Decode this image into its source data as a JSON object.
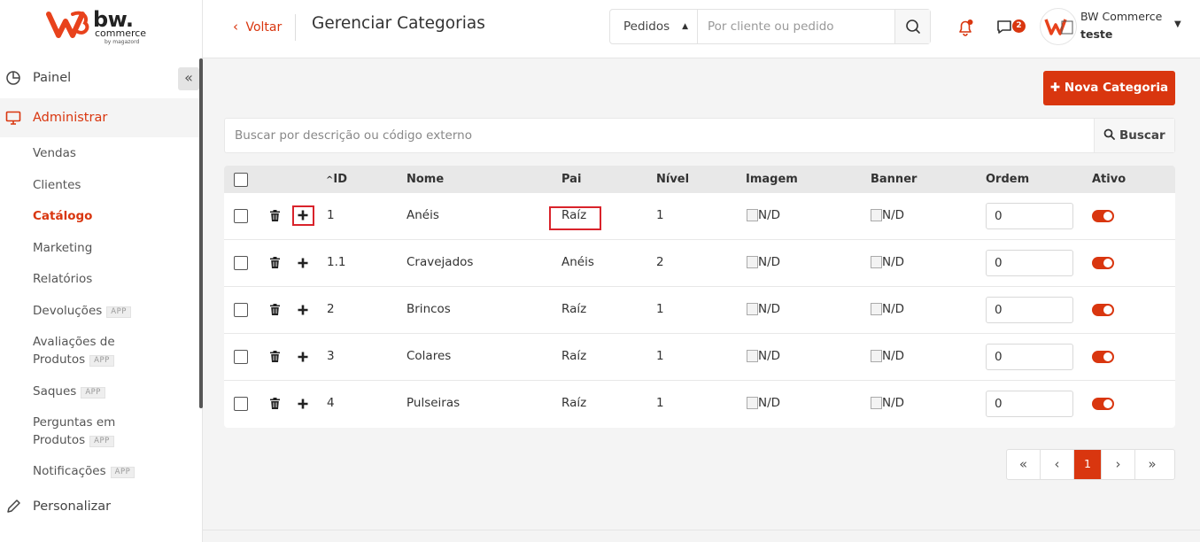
{
  "brand": {
    "name": "bw.",
    "sub": "commerce",
    "by": "by magazord",
    "accent": "#d9360f"
  },
  "sidebar": {
    "collapse_icon": "double-chevron-left",
    "main_items": [
      {
        "label": "Painel",
        "icon": "pie-chart-icon"
      },
      {
        "label": "Administrar",
        "icon": "monitor-icon"
      },
      {
        "label": "Personalizar",
        "icon": "pen-icon"
      }
    ],
    "sub_items": [
      {
        "label": "Vendas"
      },
      {
        "label": "Clientes"
      },
      {
        "label": "Catálogo"
      },
      {
        "label": "Marketing"
      },
      {
        "label": "Relatórios"
      },
      {
        "label": "Devoluções",
        "badge": "APP"
      },
      {
        "label": "Avaliações de",
        "label2": "Produtos",
        "badge": "APP"
      },
      {
        "label": "Saques",
        "badge": "APP"
      },
      {
        "label": "Perguntas em",
        "label2": "Produtos",
        "badge": "APP"
      },
      {
        "label": "Notificações",
        "badge": "APP"
      }
    ]
  },
  "header": {
    "back_label": "Voltar",
    "title": "Gerenciar Categorias",
    "search_type": "Pedidos",
    "search_placeholder": "Por cliente ou pedido",
    "chat_count": "2",
    "user_name": "BW Commerce",
    "user_store": "teste"
  },
  "toolbar": {
    "new_label": "Nova Categoria"
  },
  "list_search": {
    "placeholder": "Buscar por descrição ou código externo",
    "button": "Buscar"
  },
  "table": {
    "columns": [
      "ID",
      "Nome",
      "Pai",
      "Nível",
      "Imagem",
      "Banner",
      "Ordem",
      "Ativo"
    ],
    "rows": [
      {
        "id": "1",
        "nome": "Anéis",
        "pai": "Raíz",
        "nivel": "1",
        "imagem": "N/D",
        "banner": "N/D",
        "ordem": "0",
        "ativo": true
      },
      {
        "id": "1.1",
        "nome": "Cravejados",
        "pai": "Anéis",
        "nivel": "2",
        "imagem": "N/D",
        "banner": "N/D",
        "ordem": "0",
        "ativo": true
      },
      {
        "id": "2",
        "nome": "Brincos",
        "pai": "Raíz",
        "nivel": "1",
        "imagem": "N/D",
        "banner": "N/D",
        "ordem": "0",
        "ativo": true
      },
      {
        "id": "3",
        "nome": "Colares",
        "pai": "Raíz",
        "nivel": "1",
        "imagem": "N/D",
        "banner": "N/D",
        "ordem": "0",
        "ativo": true
      },
      {
        "id": "4",
        "nome": "Pulseiras",
        "pai": "Raíz",
        "nivel": "1",
        "imagem": "N/D",
        "banner": "N/D",
        "ordem": "0",
        "ativo": true
      }
    ]
  },
  "pagination": {
    "first": "«",
    "prev": "‹",
    "current": "1",
    "next": "›",
    "last": "»"
  }
}
